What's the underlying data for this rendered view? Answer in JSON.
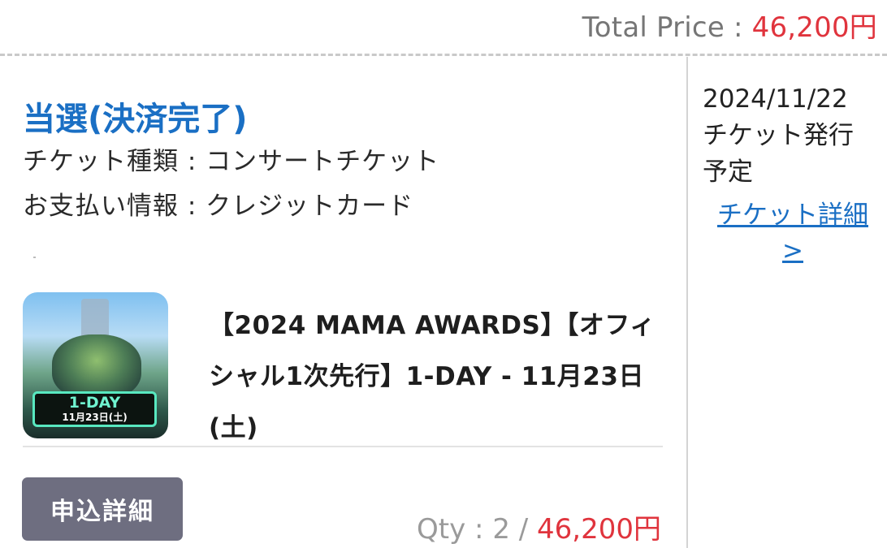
{
  "header": {
    "total_label": "Total Price : ",
    "total_value": "46,200円"
  },
  "order": {
    "status": "当選(決済完了)",
    "ticket_type": "チケット種類 : コンサートチケット",
    "payment_info": "お支払い情報 : クレジットカード",
    "item": {
      "thumbnail_badge": "1-DAY",
      "thumbnail_date": "11月23日(土)",
      "title": "【2024 MAMA AWARDS】【オフィシャル1次先行】1-DAY - 11月23日(土)"
    },
    "detail_button": "申込詳細",
    "qty_label": "Qty : 2 / ",
    "qty_price": "46,200円"
  },
  "side": {
    "issue_date": "2024/11/22",
    "issue_text": "チケット発行予定",
    "detail_link": "チケット詳細 >"
  },
  "colors": {
    "accent_blue": "#1a6fc4",
    "price_red": "#e0343d",
    "button_gray": "#6e6e80"
  }
}
